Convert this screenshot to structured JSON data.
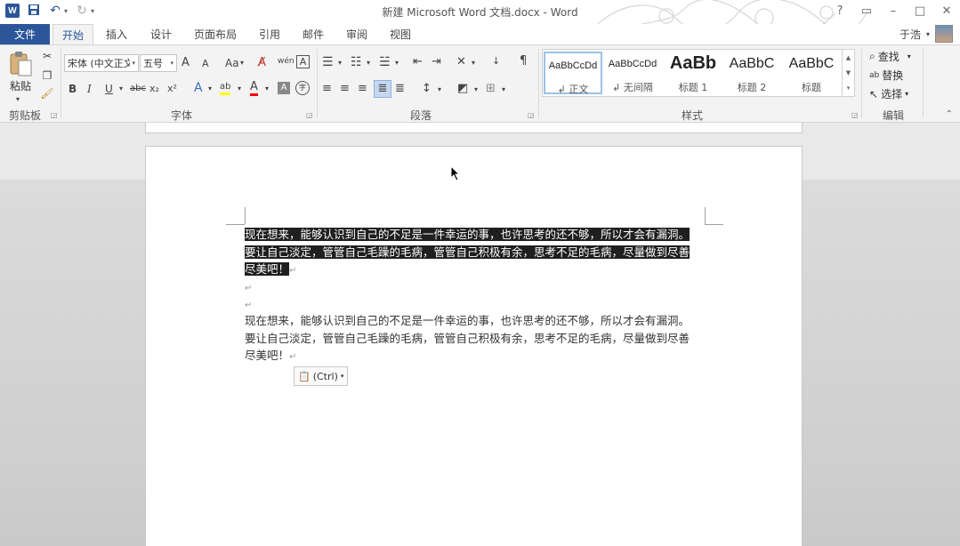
{
  "title": "新建 Microsoft Word 文档.docx - Word",
  "user": {
    "name": "于浩"
  },
  "qat": {
    "app_icon": "W",
    "undo_drop": "▾",
    "customize": "▾"
  },
  "tabs": {
    "file": "文件",
    "items": [
      "开始",
      "插入",
      "设计",
      "页面布局",
      "引用",
      "邮件",
      "审阅",
      "视图"
    ],
    "active": "开始"
  },
  "clipboard": {
    "paste": "粘贴",
    "label": "剪贴板"
  },
  "font": {
    "family": "宋体 (中文正文",
    "size": "五号",
    "grow": "A",
    "shrink": "A",
    "change_case": "Aa",
    "phonetic": "wén",
    "border_char": "A",
    "bold": "B",
    "italic": "I",
    "underline": "U",
    "strike": "abc",
    "subscript": "x₂",
    "superscript": "x²",
    "effects": "A",
    "highlight": "ab",
    "color": "A",
    "shading": "A",
    "enclose": "字",
    "label": "字体"
  },
  "paragraph": {
    "label": "段落"
  },
  "styles": {
    "label": "样式",
    "items": [
      {
        "sample": "AaBbCcDd",
        "name": "↲ 正文"
      },
      {
        "sample": "AaBbCcDd",
        "name": "↲ 无间隔"
      },
      {
        "sample": "AaBb",
        "name": "标题 1"
      },
      {
        "sample": "AaBbC",
        "name": "标题 2"
      },
      {
        "sample": "AaBbC",
        "name": "标题"
      }
    ]
  },
  "editing": {
    "find": "查找",
    "replace": "替换",
    "select": "选择",
    "label": "编辑"
  },
  "document": {
    "sel_lines": [
      "现在想来，能够认识到自己的不足是一件幸运的事，也许思考的还不够，所以才会有漏洞。",
      "要让自己淡定，管管自己毛躁的毛病，管管自己积极有余，思考不足的毛病，尽量做到尽善",
      "尽美吧！"
    ],
    "lines": [
      "现在想来，能够认识到自己的不足是一件幸运的事，也许思考的还不够，所以才会有漏洞。",
      "要让自己淡定，管管自己毛躁的毛病，管管自己积极有余，思考不足的毛病，尽量做到尽善",
      "尽美吧！"
    ],
    "para_mark": "↵",
    "paste_options": "(Ctrl)"
  },
  "colors": {
    "accent": "#2b579a",
    "highlight": "#ffff00",
    "font_color": "#ff0000",
    "selection": "#1f1f1f"
  }
}
